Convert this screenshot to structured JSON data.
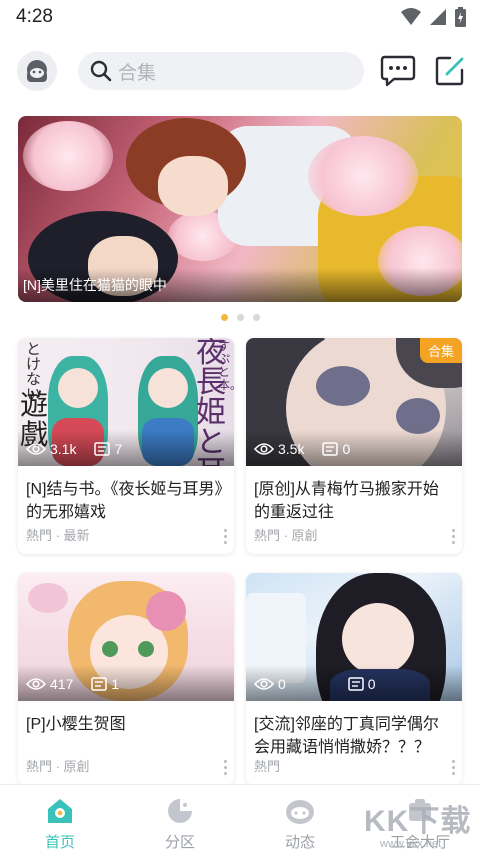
{
  "status_bar": {
    "time": "4:28",
    "icons": [
      "wifi-icon",
      "signal-icon",
      "battery-charging-icon"
    ]
  },
  "header": {
    "avatar_icon": "user-avatar-icon",
    "search": {
      "icon": "search-icon",
      "placeholder": "合集"
    },
    "actions": [
      "message-icon",
      "edit-icon"
    ]
  },
  "banner": {
    "caption": "[N]美里住在猫猫的眼中",
    "page_count": 3,
    "active_index": 0
  },
  "cards": [
    {
      "views": "3.1k",
      "comments": "7",
      "badge": "",
      "title": "[N]结与书。《夜长姬与耳男》的无邪嬉戏",
      "meta": "熱門 · 最新",
      "thumb_text_a": "とけない",
      "thumb_text_b": "遊戲",
      "thumb_text_c": "夜長姫と耳",
      "thumb_text_d": "すぷと本。"
    },
    {
      "views": "3.5k",
      "comments": "0",
      "badge": "合集",
      "title": "[原创]从青梅竹马搬家开始的重返过往",
      "meta": "熱門 · 原創"
    },
    {
      "views": "417",
      "comments": "1",
      "badge": "",
      "title": "[P]小樱生贺图",
      "meta": "熱門 · 原創"
    },
    {
      "views": "0",
      "comments": "0",
      "badge": "",
      "title": "[交流]邻座的丁真同学偶尔会用藏语悄悄撒娇？？？",
      "meta": "熱門"
    }
  ],
  "bottom_nav": [
    {
      "label": "首页",
      "icon": "home-icon",
      "active": true
    },
    {
      "label": "分区",
      "icon": "category-icon",
      "active": false
    },
    {
      "label": "动态",
      "icon": "feed-icon",
      "active": false
    },
    {
      "label": "工会大厅",
      "icon": "guild-icon",
      "active": false
    }
  ],
  "watermark": {
    "main": "KK下载",
    "sub": "www.kkx.net"
  },
  "colors": {
    "accent": "#39c2ba",
    "badge": "#f5a323",
    "dot_active": "#f5b83d"
  }
}
